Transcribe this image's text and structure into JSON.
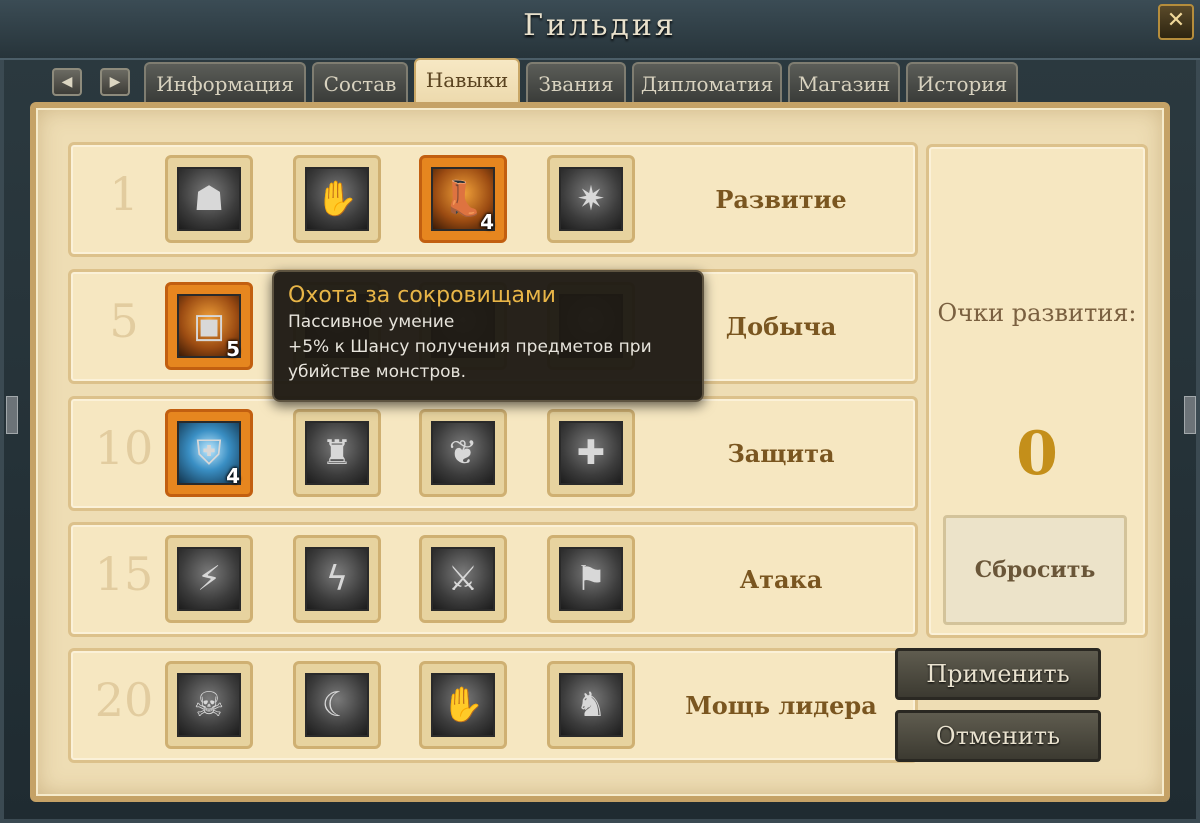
{
  "window": {
    "title": "Гильдия",
    "close_icon": "close-icon"
  },
  "nav": {
    "prev_icon": "triangle-left-icon",
    "next_icon": "triangle-right-icon"
  },
  "tabs": [
    {
      "label": "Информация",
      "active": false
    },
    {
      "label": "Состав",
      "active": false
    },
    {
      "label": "Навыки",
      "active": true
    },
    {
      "label": "Звания",
      "active": false
    },
    {
      "label": "Дипломатия",
      "active": false
    },
    {
      "label": "Магазин",
      "active": false
    },
    {
      "label": "История",
      "active": false
    }
  ],
  "skill_rows": [
    {
      "level": "1",
      "name": "Развитие",
      "skills": [
        {
          "icon": "shadow-figure-icon",
          "learned": false,
          "rank": ""
        },
        {
          "icon": "grasping-hand-icon",
          "learned": false,
          "rank": ""
        },
        {
          "icon": "boot-icon",
          "learned": true,
          "rank": "4"
        },
        {
          "icon": "energy-burst-icon",
          "learned": false,
          "rank": ""
        }
      ]
    },
    {
      "level": "5",
      "name": "Добыча",
      "skills": [
        {
          "icon": "treasure-chest-icon",
          "learned": true,
          "rank": "5"
        },
        {
          "icon": "hidden-skill-icon",
          "learned": false,
          "rank": ""
        },
        {
          "icon": "hidden-skill-icon",
          "learned": false,
          "rank": ""
        },
        {
          "icon": "hidden-skill-icon",
          "learned": false,
          "rank": ""
        }
      ]
    },
    {
      "level": "10",
      "name": "Защита",
      "skills": [
        {
          "icon": "glowing-shield-icon",
          "learned": true,
          "rank": "4"
        },
        {
          "icon": "armored-knight-icon",
          "learned": false,
          "rank": ""
        },
        {
          "icon": "winged-emblem-icon",
          "learned": false,
          "rank": ""
        },
        {
          "icon": "cross-banner-icon",
          "learned": false,
          "rank": ""
        }
      ]
    },
    {
      "level": "15",
      "name": "Атака",
      "skills": [
        {
          "icon": "slash-strike-icon",
          "learned": false,
          "rank": ""
        },
        {
          "icon": "lightning-banner-icon",
          "learned": false,
          "rank": ""
        },
        {
          "icon": "warrior-icon",
          "learned": false,
          "rank": ""
        },
        {
          "icon": "wolf-banner-icon",
          "learned": false,
          "rank": ""
        }
      ]
    },
    {
      "level": "20",
      "name": "Мощь лидера",
      "skills": [
        {
          "icon": "skull-icon",
          "learned": false,
          "rank": ""
        },
        {
          "icon": "raven-icon",
          "learned": false,
          "rank": ""
        },
        {
          "icon": "open-palm-icon",
          "learned": false,
          "rank": ""
        },
        {
          "icon": "strongman-icon",
          "learned": false,
          "rank": ""
        }
      ]
    }
  ],
  "points": {
    "label": "Очки развития:",
    "value": "0"
  },
  "buttons": {
    "reset": "Сбросить",
    "apply": "Применить",
    "cancel": "Отменить"
  },
  "tooltip": {
    "title": "Охота за сокровищами",
    "type": "Пассивное умение",
    "desc1": "+5% к Шансу получения предметов при",
    "desc2": "убийстве монстров."
  }
}
